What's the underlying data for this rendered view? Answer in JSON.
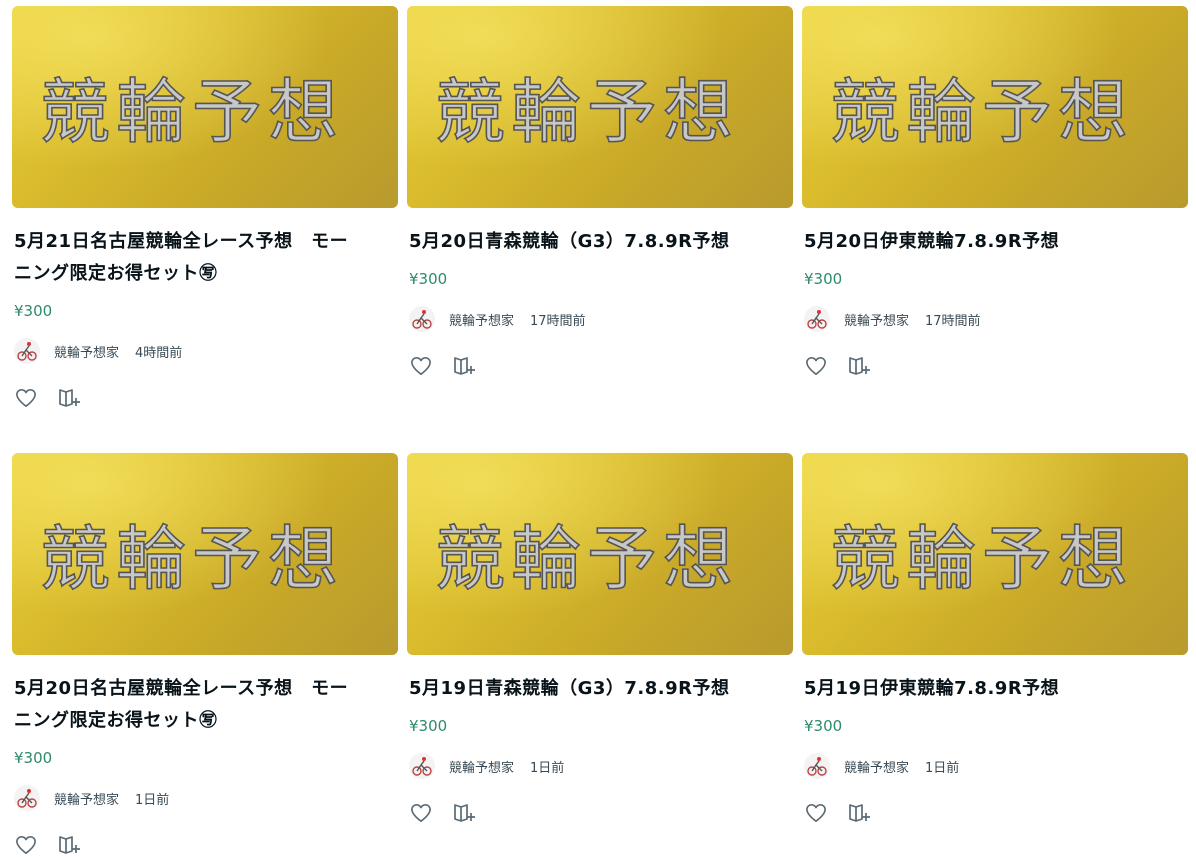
{
  "thumbnail_text": "競輪予想",
  "colors": {
    "price": "#2d8a6e",
    "thumbnail_gold": "#d9bb2c"
  },
  "icons": {
    "like": "heart-icon",
    "save": "magazine-add-icon",
    "avatar": "cyclist-avatar-icon"
  },
  "cards": [
    {
      "title": "5月21日名古屋競輪全レース予想　モー\nニング限定お得セット㊢",
      "price": "¥300",
      "author": "競輪予想家",
      "time": "4時間前"
    },
    {
      "title": "5月20日青森競輪（G3）7.8.9R予想",
      "price": "¥300",
      "author": "競輪予想家",
      "time": "17時間前"
    },
    {
      "title": "5月20日伊東競輪7.8.9R予想",
      "price": "¥300",
      "author": "競輪予想家",
      "time": "17時間前"
    },
    {
      "title": "5月20日名古屋競輪全レース予想　モー\nニング限定お得セット㊢",
      "price": "¥300",
      "author": "競輪予想家",
      "time": "1日前"
    },
    {
      "title": "5月19日青森競輪（G3）7.8.9R予想",
      "price": "¥300",
      "author": "競輪予想家",
      "time": "1日前"
    },
    {
      "title": "5月19日伊東競輪7.8.9R予想",
      "price": "¥300",
      "author": "競輪予想家",
      "time": "1日前"
    }
  ]
}
